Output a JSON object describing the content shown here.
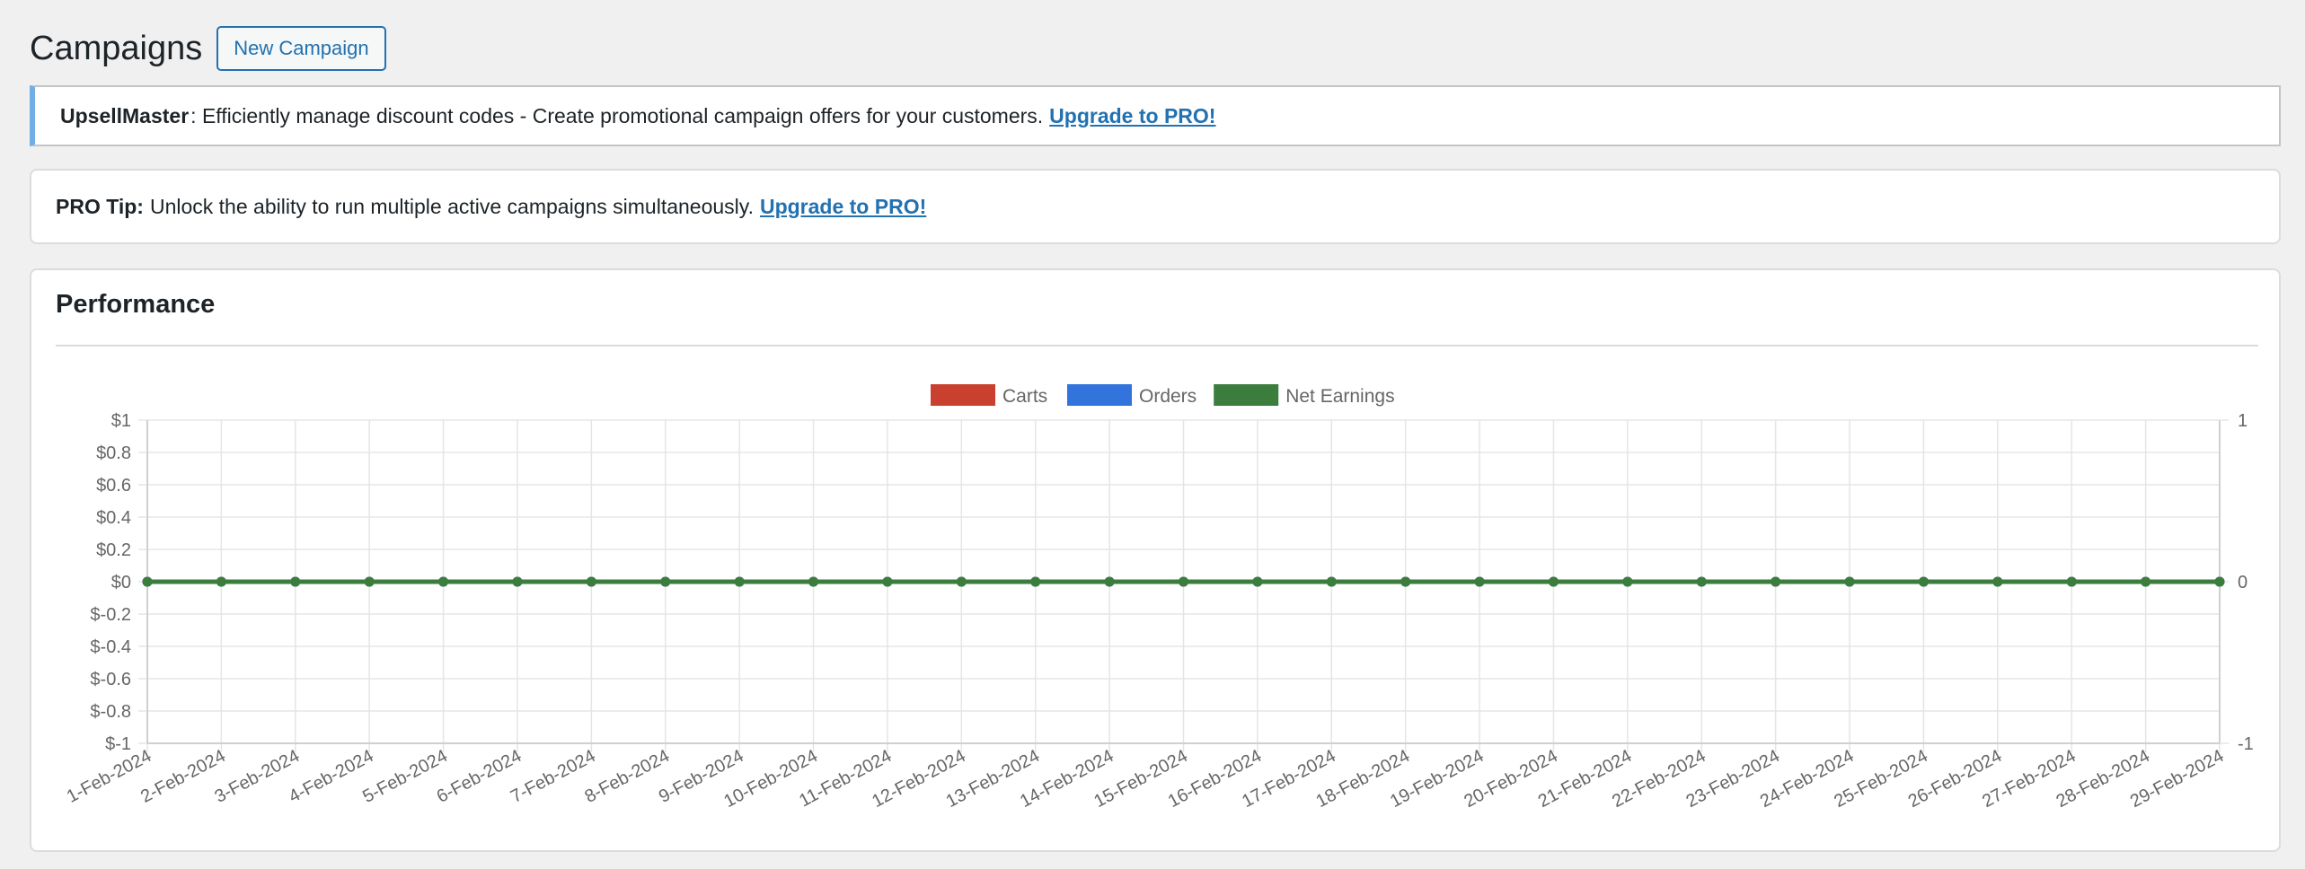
{
  "header": {
    "title": "Campaigns",
    "new_button": "New Campaign"
  },
  "notice": {
    "brand": "UpsellMaster",
    "message": ": Efficiently manage discount codes - Create promotional campaign offers for your customers.",
    "link": "Upgrade to PRO!"
  },
  "tip": {
    "label": "PRO Tip:",
    "message": "Unlock the ability to run multiple active campaigns simultaneously.",
    "link": "Upgrade to PRO!"
  },
  "performance": {
    "title": "Performance"
  },
  "chart_data": {
    "type": "line",
    "x": [
      "1-Feb-2024",
      "2-Feb-2024",
      "3-Feb-2024",
      "4-Feb-2024",
      "5-Feb-2024",
      "6-Feb-2024",
      "7-Feb-2024",
      "8-Feb-2024",
      "9-Feb-2024",
      "10-Feb-2024",
      "11-Feb-2024",
      "12-Feb-2024",
      "13-Feb-2024",
      "14-Feb-2024",
      "15-Feb-2024",
      "16-Feb-2024",
      "17-Feb-2024",
      "18-Feb-2024",
      "19-Feb-2024",
      "20-Feb-2024",
      "21-Feb-2024",
      "22-Feb-2024",
      "23-Feb-2024",
      "24-Feb-2024",
      "25-Feb-2024",
      "26-Feb-2024",
      "27-Feb-2024",
      "28-Feb-2024",
      "29-Feb-2024"
    ],
    "series": [
      {
        "name": "Carts",
        "color": "#c9402f",
        "axis": "right",
        "values": [
          0,
          0,
          0,
          0,
          0,
          0,
          0,
          0,
          0,
          0,
          0,
          0,
          0,
          0,
          0,
          0,
          0,
          0,
          0,
          0,
          0,
          0,
          0,
          0,
          0,
          0,
          0,
          0,
          0
        ]
      },
      {
        "name": "Orders",
        "color": "#3273dc",
        "axis": "right",
        "values": [
          0,
          0,
          0,
          0,
          0,
          0,
          0,
          0,
          0,
          0,
          0,
          0,
          0,
          0,
          0,
          0,
          0,
          0,
          0,
          0,
          0,
          0,
          0,
          0,
          0,
          0,
          0,
          0,
          0
        ]
      },
      {
        "name": "Net Earnings",
        "color": "#3a7d3c",
        "axis": "left",
        "values": [
          0,
          0,
          0,
          0,
          0,
          0,
          0,
          0,
          0,
          0,
          0,
          0,
          0,
          0,
          0,
          0,
          0,
          0,
          0,
          0,
          0,
          0,
          0,
          0,
          0,
          0,
          0,
          0,
          0
        ]
      }
    ],
    "y_left": {
      "ticks": [
        "$1",
        "$0.8",
        "$0.6",
        "$0.4",
        "$0.2",
        "$0",
        "$-0.2",
        "$-0.4",
        "$-0.6",
        "$-0.8",
        "$-1"
      ],
      "ylim": [
        -1,
        1
      ]
    },
    "y_right": {
      "ticks": [
        "1",
        "0",
        "-1"
      ],
      "ylim": [
        -1,
        1
      ]
    },
    "legend_position": "top-center",
    "grid": true
  }
}
